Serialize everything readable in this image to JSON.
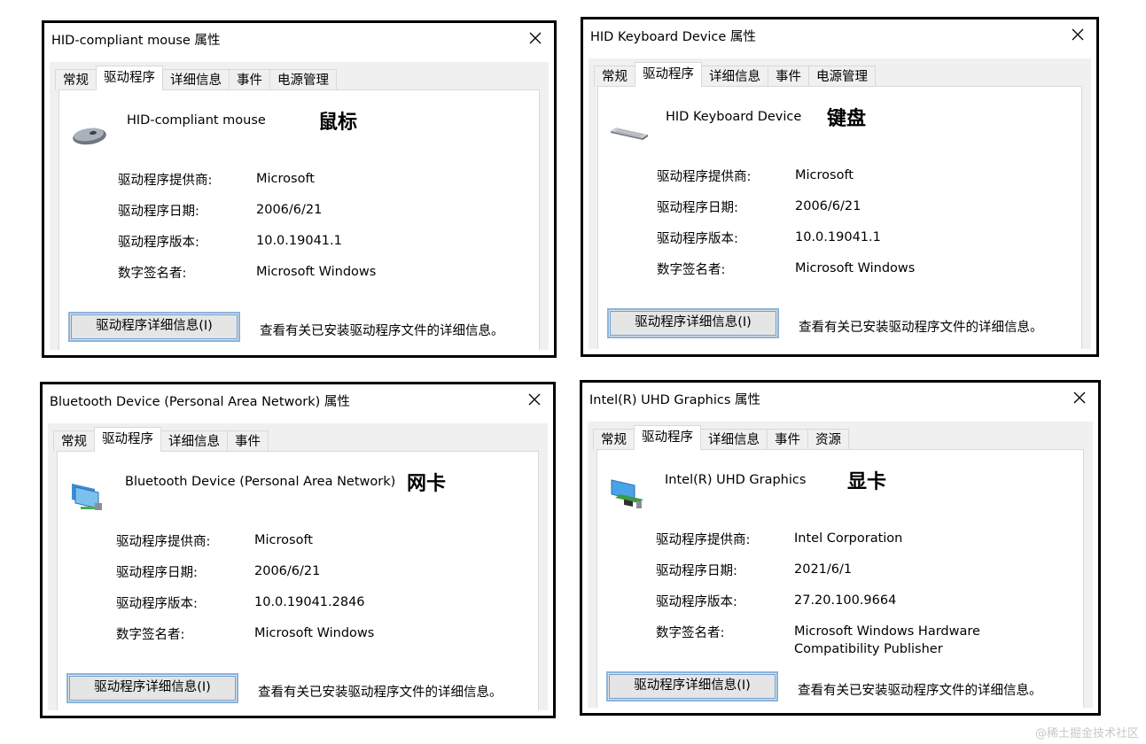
{
  "dialogs": [
    {
      "title": "HID-compliant mouse 属性",
      "tabs": [
        "常规",
        "驱动程序",
        "详细信息",
        "事件",
        "电源管理"
      ],
      "active_tab": 1,
      "device_name": "HID-compliant mouse",
      "category": "鼠标",
      "icon": "mouse-icon",
      "rows": [
        {
          "label": "驱动程序提供商:",
          "value": "Microsoft"
        },
        {
          "label": "驱动程序日期:",
          "value": "2006/6/21"
        },
        {
          "label": "驱动程序版本:",
          "value": "10.0.19041.1"
        },
        {
          "label": "数字签名者:",
          "value": "Microsoft Windows"
        }
      ],
      "button_label": "驱动程序详细信息(I)",
      "button_desc": "查看有关已安装驱动程序文件的详细信息。"
    },
    {
      "title": "HID Keyboard Device 属性",
      "tabs": [
        "常规",
        "驱动程序",
        "详细信息",
        "事件",
        "电源管理"
      ],
      "active_tab": 1,
      "device_name": "HID Keyboard Device",
      "category": "键盘",
      "icon": "keyboard-icon",
      "rows": [
        {
          "label": "驱动程序提供商:",
          "value": "Microsoft"
        },
        {
          "label": "驱动程序日期:",
          "value": "2006/6/21"
        },
        {
          "label": "驱动程序版本:",
          "value": "10.0.19041.1"
        },
        {
          "label": "数字签名者:",
          "value": "Microsoft Windows"
        }
      ],
      "button_label": "驱动程序详细信息(I)",
      "button_desc": "查看有关已安装驱动程序文件的详细信息。"
    },
    {
      "title": "Bluetooth Device (Personal Area Network) 属性",
      "tabs": [
        "常规",
        "驱动程序",
        "详细信息",
        "事件"
      ],
      "active_tab": 1,
      "device_name": "Bluetooth Device (Personal Area Network)",
      "category": "网卡",
      "icon": "network-adapter-icon",
      "rows": [
        {
          "label": "驱动程序提供商:",
          "value": "Microsoft"
        },
        {
          "label": "驱动程序日期:",
          "value": "2006/6/21"
        },
        {
          "label": "驱动程序版本:",
          "value": "10.0.19041.2846"
        },
        {
          "label": "数字签名者:",
          "value": "Microsoft Windows"
        }
      ],
      "button_label": "驱动程序详细信息(I)",
      "button_desc": "查看有关已安装驱动程序文件的详细信息。"
    },
    {
      "title": "Intel(R) UHD Graphics 属性",
      "tabs": [
        "常规",
        "驱动程序",
        "详细信息",
        "事件",
        "资源"
      ],
      "active_tab": 1,
      "device_name": "Intel(R) UHD Graphics",
      "category": "显卡",
      "icon": "display-adapter-icon",
      "rows": [
        {
          "label": "驱动程序提供商:",
          "value": "Intel Corporation"
        },
        {
          "label": "驱动程序日期:",
          "value": "2021/6/1"
        },
        {
          "label": "驱动程序版本:",
          "value": "27.20.100.9664"
        },
        {
          "label": "数字签名者:",
          "value": "Microsoft Windows Hardware Compatibility Publisher"
        }
      ],
      "button_label": "驱动程序详细信息(I)",
      "button_desc": "查看有关已安装驱动程序文件的详细信息。"
    }
  ],
  "watermark": "@稀土掘金技术社区"
}
